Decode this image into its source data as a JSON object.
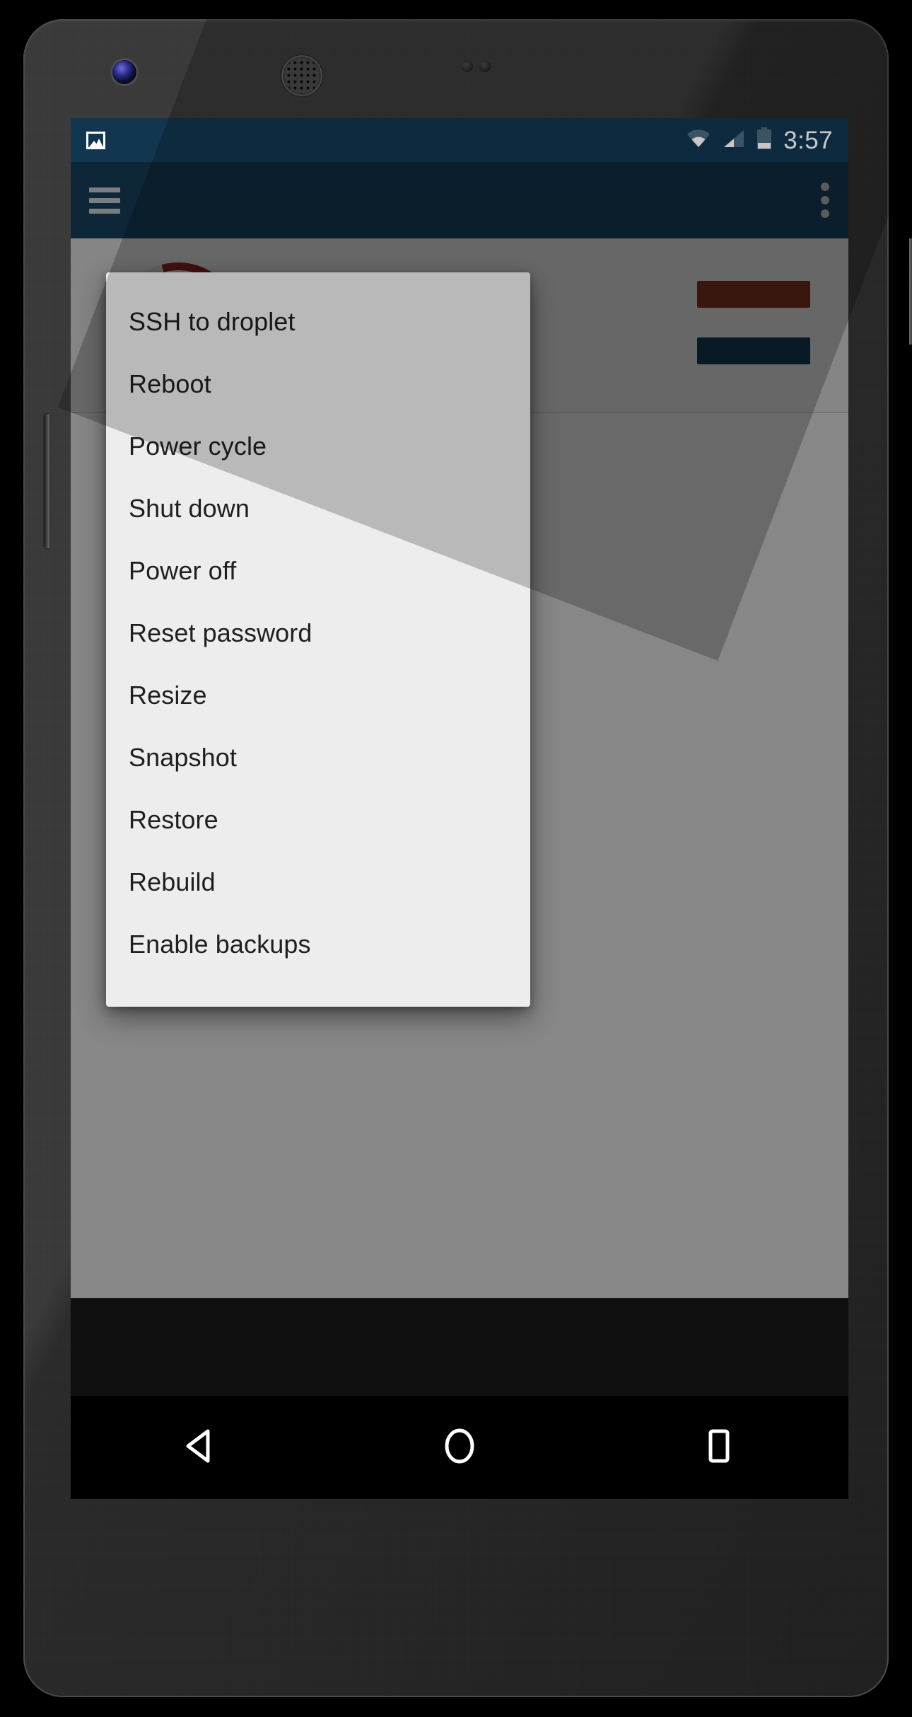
{
  "status_bar": {
    "image_icon": "image-icon",
    "wifi_icon": "wifi-icon",
    "cellular_icon": "cellular-signal-icon",
    "battery_icon": "battery-icon",
    "time": "3:57"
  },
  "app_bar": {
    "menu_icon": "hamburger-menu-icon",
    "overflow_icon": "overflow-menu-icon"
  },
  "dialog": {
    "items": [
      {
        "label": "SSH to droplet"
      },
      {
        "label": "Reboot"
      },
      {
        "label": "Power cycle"
      },
      {
        "label": "Shut down"
      },
      {
        "label": "Power off"
      },
      {
        "label": "Reset password"
      },
      {
        "label": "Resize"
      },
      {
        "label": "Snapshot"
      },
      {
        "label": "Restore"
      },
      {
        "label": "Rebuild"
      },
      {
        "label": "Enable backups"
      }
    ]
  },
  "nav_bar": {
    "back": "back-icon",
    "home": "home-icon",
    "recents": "recents-icon"
  },
  "colors": {
    "status_bar": "#123650",
    "app_bar": "#1b4a6b",
    "dialog_bg": "#ededed",
    "dialog_text": "#1f1f1f",
    "accent_red": "#a02828",
    "accent_blue": "#15405c"
  }
}
